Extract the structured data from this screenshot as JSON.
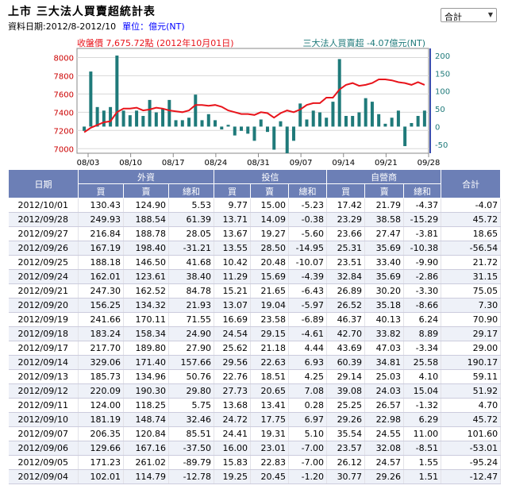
{
  "header": {
    "title": "上市 三大法人買賣超統計表",
    "date_range": "資料日期:2012/8-2012/10",
    "unit": "單位：億元(NT)"
  },
  "market_select": {
    "value": "合計"
  },
  "chart_data": {
    "type": "bar+line",
    "price_label": "收盤價 7,675.72點 (2012年10月01日)",
    "net_label": "三大法人買賣超 -4.07億元(NT)",
    "left_axis": {
      "ticks": [
        "8000",
        "7800",
        "7600",
        "7400",
        "7200",
        "7000"
      ],
      "range": [
        6950,
        8100
      ]
    },
    "right_axis": {
      "ticks": [
        "200",
        "150",
        "100",
        "50",
        "0",
        "-50"
      ],
      "range": [
        -75,
        220
      ]
    },
    "x_ticks": [
      "08/03",
      "08/10",
      "08/17",
      "08/24",
      "08/31",
      "09/07",
      "09/14",
      "09/21",
      "09/28"
    ],
    "colors": {
      "bars": "#1f7a7a",
      "line": "#e8141b",
      "price_label": "#e8141b",
      "net_label": "#1f7a7a"
    },
    "bars": [
      -12,
      155,
      55,
      45,
      55,
      200,
      45,
      32,
      45,
      30,
      75,
      40,
      50,
      75,
      18,
      18,
      25,
      90,
      18,
      35,
      18,
      -8,
      5,
      -25,
      -12,
      -20,
      -40,
      20,
      -15,
      -65,
      15,
      -75,
      -40,
      65,
      20,
      45,
      40,
      25,
      70,
      190,
      30,
      30,
      40,
      80,
      70,
      35,
      8,
      25,
      45,
      -55,
      10,
      30,
      45
    ],
    "price": [
      7180,
      7230,
      7260,
      7290,
      7300,
      7400,
      7440,
      7440,
      7450,
      7420,
      7430,
      7450,
      7440,
      7420,
      7410,
      7400,
      7420,
      7480,
      7480,
      7470,
      7480,
      7460,
      7420,
      7400,
      7380,
      7380,
      7370,
      7400,
      7390,
      7340,
      7390,
      7420,
      7400,
      7430,
      7480,
      7500,
      7500,
      7560,
      7560,
      7650,
      7700,
      7720,
      7690,
      7700,
      7720,
      7760,
      7760,
      7750,
      7730,
      7720,
      7700,
      7730,
      7700
    ]
  },
  "table": {
    "group_headers": [
      "日期",
      "外資",
      "投信",
      "自營商",
      "合計"
    ],
    "sub_headers": [
      "買",
      "賣",
      "總和",
      "買",
      "賣",
      "總和",
      "買",
      "賣",
      "總和"
    ],
    "rows": [
      [
        "2012/10/01",
        "130.43",
        "124.90",
        "5.53",
        "9.77",
        "15.00",
        "-5.23",
        "17.42",
        "21.79",
        "-4.37",
        "-4.07"
      ],
      [
        "2012/09/28",
        "249.93",
        "188.54",
        "61.39",
        "13.71",
        "14.09",
        "-0.38",
        "23.29",
        "38.58",
        "-15.29",
        "45.72"
      ],
      [
        "2012/09/27",
        "216.84",
        "188.78",
        "28.05",
        "13.67",
        "19.27",
        "-5.60",
        "23.66",
        "27.47",
        "-3.81",
        "18.65"
      ],
      [
        "2012/09/26",
        "167.19",
        "198.40",
        "-31.21",
        "13.55",
        "28.50",
        "-14.95",
        "25.31",
        "35.69",
        "-10.38",
        "-56.54"
      ],
      [
        "2012/09/25",
        "188.18",
        "146.50",
        "41.68",
        "10.42",
        "20.48",
        "-10.07",
        "23.51",
        "33.40",
        "-9.90",
        "21.72"
      ],
      [
        "2012/09/24",
        "162.01",
        "123.61",
        "38.40",
        "11.29",
        "15.69",
        "-4.39",
        "32.84",
        "35.69",
        "-2.86",
        "31.15"
      ],
      [
        "2012/09/21",
        "247.30",
        "162.52",
        "84.78",
        "15.21",
        "21.65",
        "-6.43",
        "26.89",
        "30.20",
        "-3.30",
        "75.05"
      ],
      [
        "2012/09/20",
        "156.25",
        "134.32",
        "21.93",
        "13.07",
        "19.04",
        "-5.97",
        "26.52",
        "35.18",
        "-8.66",
        "7.30"
      ],
      [
        "2012/09/19",
        "241.66",
        "170.11",
        "71.55",
        "16.69",
        "23.58",
        "-6.89",
        "46.37",
        "40.13",
        "6.24",
        "70.90"
      ],
      [
        "2012/09/18",
        "183.24",
        "158.34",
        "24.90",
        "24.54",
        "29.15",
        "-4.61",
        "42.70",
        "33.82",
        "8.89",
        "29.17"
      ],
      [
        "2012/09/17",
        "217.70",
        "189.80",
        "27.90",
        "25.62",
        "21.18",
        "4.44",
        "43.69",
        "47.03",
        "-3.34",
        "29.00"
      ],
      [
        "2012/09/14",
        "329.06",
        "171.40",
        "157.66",
        "29.56",
        "22.63",
        "6.93",
        "60.39",
        "34.81",
        "25.58",
        "190.17"
      ],
      [
        "2012/09/13",
        "185.73",
        "134.96",
        "50.76",
        "22.76",
        "18.51",
        "4.25",
        "29.14",
        "25.03",
        "4.10",
        "59.11"
      ],
      [
        "2012/09/12",
        "220.09",
        "190.30",
        "29.80",
        "27.73",
        "20.65",
        "7.08",
        "39.08",
        "24.03",
        "15.04",
        "51.92"
      ],
      [
        "2012/09/11",
        "124.00",
        "118.25",
        "5.75",
        "13.68",
        "13.41",
        "0.28",
        "25.25",
        "26.57",
        "-1.32",
        "4.70"
      ],
      [
        "2012/09/10",
        "181.19",
        "148.74",
        "32.46",
        "24.72",
        "17.75",
        "6.97",
        "29.26",
        "22.98",
        "6.29",
        "45.72"
      ],
      [
        "2012/09/07",
        "206.35",
        "120.84",
        "85.51",
        "24.41",
        "19.31",
        "5.10",
        "35.54",
        "24.55",
        "11.00",
        "101.60"
      ],
      [
        "2012/09/06",
        "129.66",
        "167.16",
        "-37.50",
        "16.00",
        "23.01",
        "-7.00",
        "23.57",
        "32.08",
        "-8.51",
        "-53.01"
      ],
      [
        "2012/09/05",
        "171.23",
        "261.02",
        "-89.79",
        "15.83",
        "22.83",
        "-7.00",
        "26.12",
        "24.57",
        "1.55",
        "-95.24"
      ],
      [
        "2012/09/04",
        "102.01",
        "114.79",
        "-12.78",
        "19.25",
        "20.45",
        "-1.20",
        "30.77",
        "29.26",
        "1.51",
        "-12.47"
      ]
    ]
  }
}
